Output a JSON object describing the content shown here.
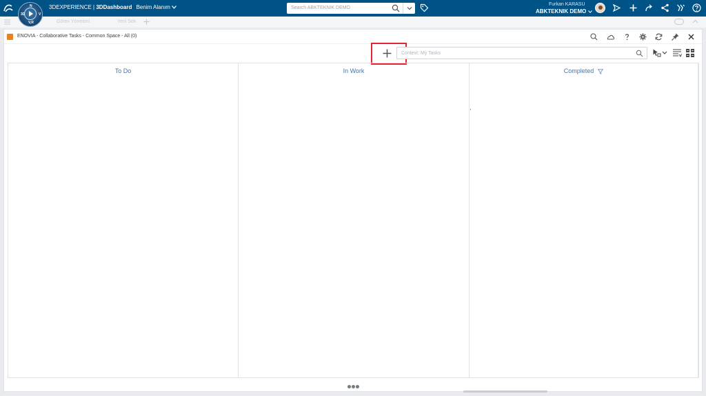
{
  "topbar": {
    "brand": "3DEXPERIENCE",
    "separator": "|",
    "app": "3DDashboard",
    "space": "Benim Alanım",
    "search_placeholder": "Search ABKTEKNIK DEMO",
    "user_name": "Furkan KARASU",
    "tenant": "ABKTEKNIK DEMO",
    "compass_labels": {
      "top": "N",
      "left": "3D",
      "right": "V",
      "bottom": "V,R"
    }
  },
  "tabstrip": {
    "tab1": "Görev Yönetimi",
    "tab2": "Yeni Sek"
  },
  "widget": {
    "title": "ENOVIA - Collaborative Tasks - Common Space - All (0)",
    "context_placeholder": "Context: My Tasks",
    "columns": [
      {
        "label": "To Do"
      },
      {
        "label": "In Work"
      },
      {
        "label": "Completed"
      }
    ]
  },
  "icons": {
    "header": [
      "search-icon",
      "cloud-icon",
      "help-icon",
      "gear-icon",
      "refresh-icon",
      "pin-icon",
      "close-icon"
    ],
    "topbar": [
      "tag-icon",
      "share-icon",
      "plus-icon",
      "forward-icon",
      "network-icon",
      "collab-icon",
      "help-icon"
    ]
  },
  "colors": {
    "topbar": "#005386",
    "column_header": "#3f76b3",
    "highlight": "#e2262f",
    "app_icon": "#e8821e"
  }
}
